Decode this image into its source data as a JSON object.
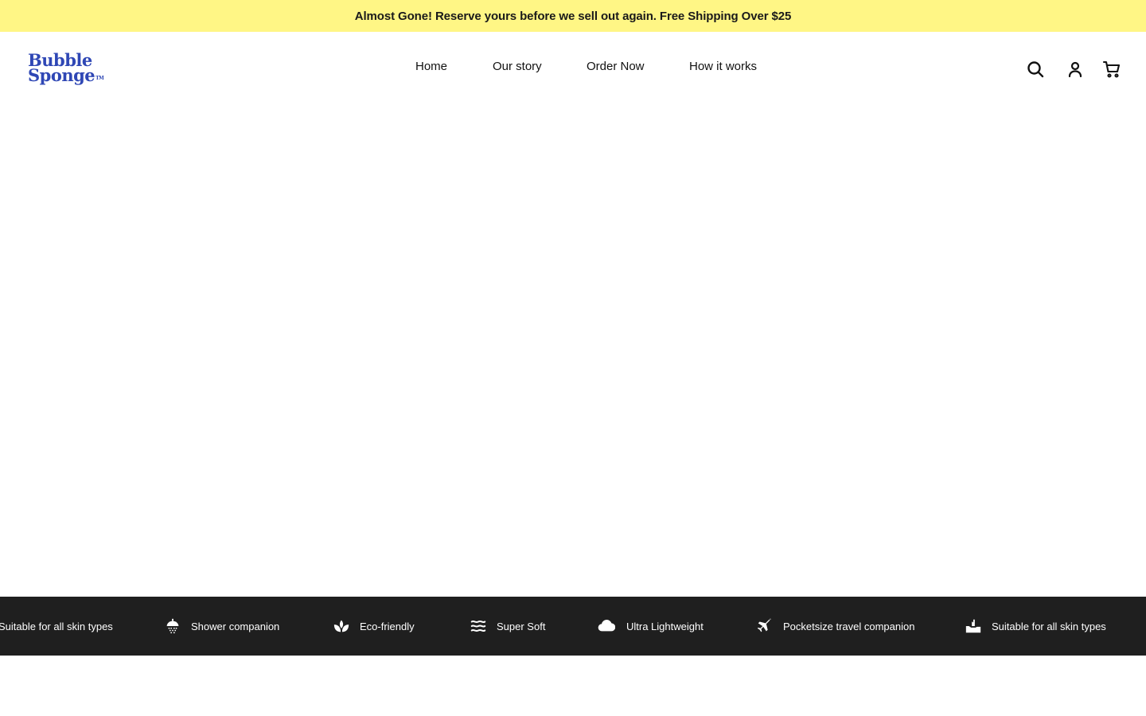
{
  "announcement": {
    "text": "Almost Gone! Reserve yours before we sell out again. Free Shipping Over $25"
  },
  "brand": {
    "line1": "Bubble",
    "line2": "Sponge",
    "trademark": "TM",
    "color": "#2f47b5"
  },
  "nav": {
    "items": [
      {
        "label": "Home"
      },
      {
        "label": "Our story"
      },
      {
        "label": "Order Now"
      },
      {
        "label": "How it works"
      }
    ]
  },
  "header_icons": [
    "search-icon",
    "account-icon",
    "cart-icon"
  ],
  "marquee": {
    "items": [
      {
        "label": "Suitable for all skin types",
        "icon": "hand-icon"
      },
      {
        "label": "Shower companion",
        "icon": "shower-icon"
      },
      {
        "label": "Eco-friendly",
        "icon": "leaf-icon"
      },
      {
        "label": "Super Soft",
        "icon": "waves-icon"
      },
      {
        "label": "Ultra Lightweight",
        "icon": "cloud-icon"
      },
      {
        "label": "Pocketsize travel companion",
        "icon": "airplane-icon"
      },
      {
        "label": "Suitable for all skin types",
        "icon": "hand-icon"
      }
    ]
  },
  "colors": {
    "announce_bg": "#fff685",
    "marquee_bg": "#1f1f1f",
    "text": "#111111"
  }
}
